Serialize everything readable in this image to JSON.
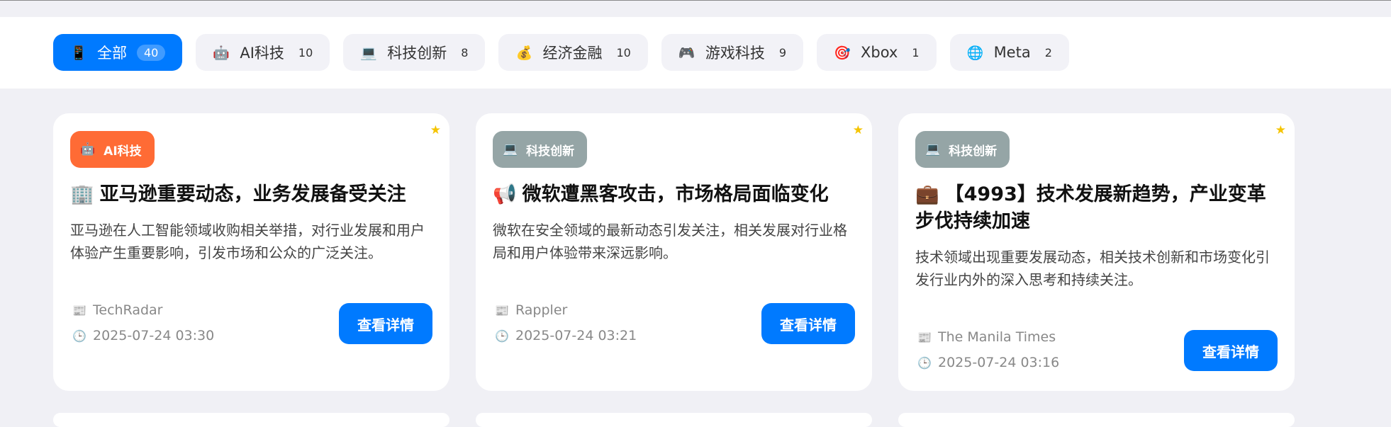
{
  "filters": [
    {
      "icon": "📱",
      "icon_name": "phone-icon",
      "label": "全部",
      "count": "40",
      "active": true
    },
    {
      "icon": "🤖",
      "icon_name": "robot-icon",
      "label": "AI科技",
      "count": "10"
    },
    {
      "icon": "💻",
      "icon_name": "computer-icon",
      "label": "科技创新",
      "count": "8"
    },
    {
      "icon": "💰",
      "icon_name": "money-bag-icon",
      "label": "经济金融",
      "count": "10"
    },
    {
      "icon": "🎮",
      "icon_name": "gamepad-icon",
      "label": "游戏科技",
      "count": "9"
    },
    {
      "icon": "🎯",
      "icon_name": "target-icon",
      "label": "Xbox",
      "count": "1"
    },
    {
      "icon": "🌐",
      "icon_name": "globe-icon",
      "label": "Meta",
      "count": "2"
    }
  ],
  "cards": [
    {
      "badge": {
        "icon": "🤖",
        "label": "AI科技",
        "color": "#ff6b35"
      },
      "title_icon": "🏢",
      "title": "亚马逊重要动态，业务发展备受关注",
      "desc": "亚马逊在人工智能领域收购相关举措，对行业发展和用户体验产生重要影响，引发市场和公众的广泛关注。",
      "source": "TechRadar",
      "time": "2025-07-24 03:30",
      "button": "查看详情",
      "star": "★"
    },
    {
      "badge": {
        "icon": "💻",
        "label": "科技创新",
        "color": "#95a5a6"
      },
      "title_icon": "📢",
      "title": "微软遭黑客攻击，市场格局面临变化",
      "desc": "微软在安全领域的最新动态引发关注，相关发展对行业格局和用户体验带来深远影响。",
      "source": "Rappler",
      "time": "2025-07-24 03:21",
      "button": "查看详情",
      "star": "★"
    },
    {
      "badge": {
        "icon": "💻",
        "label": "科技创新",
        "color": "#95a5a6"
      },
      "title_icon": "💼",
      "title": "【4993】技术发展新趋势，产业变革步伐持续加速",
      "desc": "技术领域出现重要发展动态，相关技术创新和市场变化引发行业内外的深入思考和持续关注。",
      "source": "The Manila Times",
      "time": "2025-07-24 03:16",
      "button": "查看详情",
      "star": "★"
    }
  ],
  "meta_icons": {
    "source": "📰",
    "time": "🕒"
  }
}
